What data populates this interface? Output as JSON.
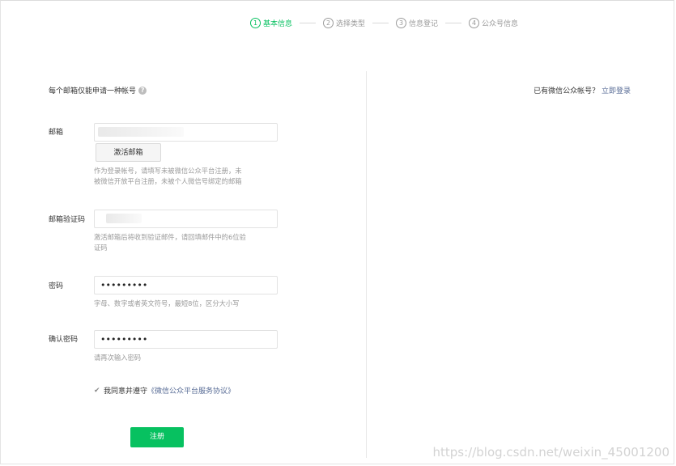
{
  "steps": [
    {
      "num": "1",
      "label": "基本信息"
    },
    {
      "num": "2",
      "label": "选择类型"
    },
    {
      "num": "3",
      "label": "信息登记"
    },
    {
      "num": "4",
      "label": "公众号信息"
    }
  ],
  "intro": "每个邮箱仅能申请一种帐号",
  "help_icon_glyph": "?",
  "form": {
    "email_label": "邮箱",
    "activate_button": "激活邮箱",
    "email_tip_line1": "作为登录帐号，请填写未被微信公众平台注册，未",
    "email_tip_line2": "被微信开放平台注册，未被个人微信号绑定的邮箱",
    "code_label": "邮箱验证码",
    "code_tip_line1": "激活邮箱后将收到验证邮件，请回填邮件中的6位验",
    "code_tip_line2": "证码",
    "password_label": "密码",
    "password_value": "•••••••••",
    "password_tip": "字母、数字或者英文符号，最短8位，区分大小写",
    "confirm_label": "确认密码",
    "confirm_value": "•••••••••",
    "confirm_tip": "请再次输入密码",
    "agree_text": "我同意并遵守",
    "agree_link": "《微信公众平台服务协议》",
    "submit_button": "注册"
  },
  "right": {
    "has_account": "已有微信公众帐号？",
    "login_link": "立即登录"
  },
  "watermark": "https://blog.csdn.net/weixin_45001200",
  "colors": {
    "accent": "#07c160",
    "link": "#576b95"
  }
}
